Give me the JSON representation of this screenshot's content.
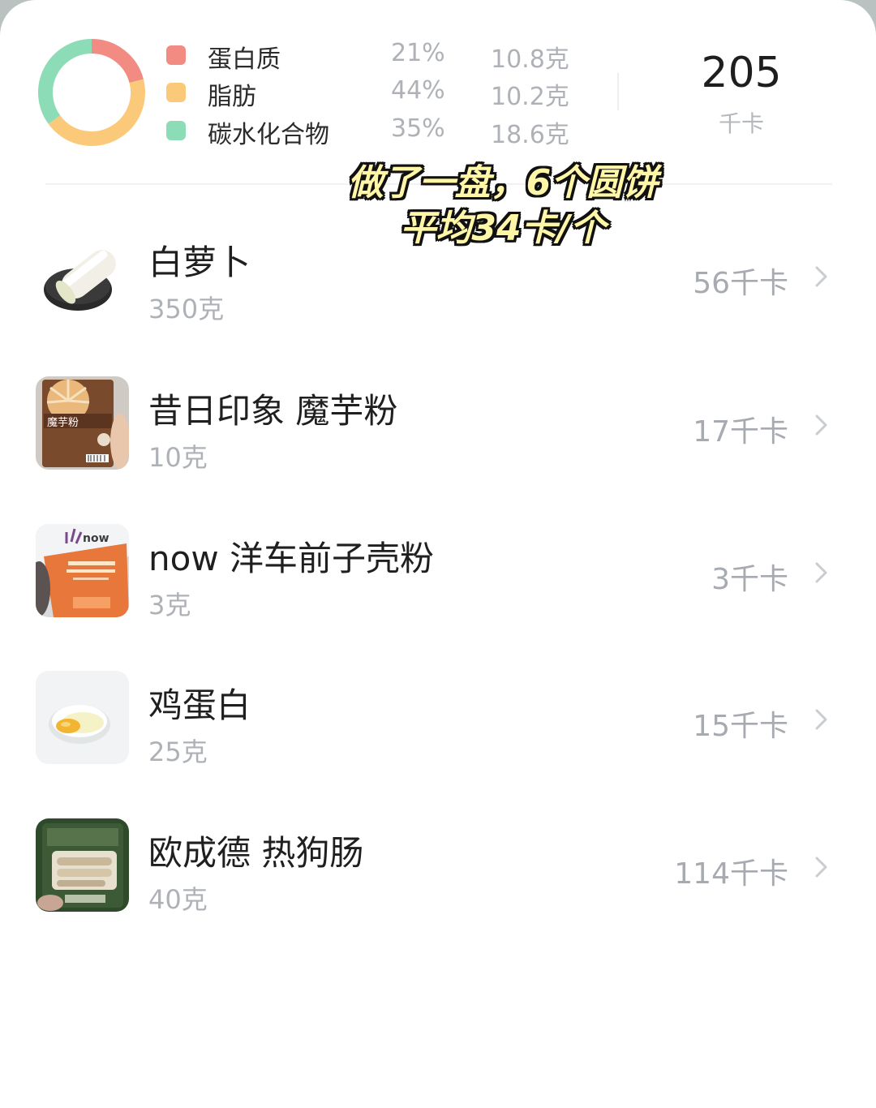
{
  "summary": {
    "macros": [
      {
        "name": "蛋白质",
        "percent": "21%",
        "weight": "10.8克",
        "color": "#f28b82",
        "share": 0.21
      },
      {
        "name": "脂肪",
        "percent": "44%",
        "weight": "10.2克",
        "color": "#fbc97a",
        "share": 0.44
      },
      {
        "name": "碳水化合物",
        "percent": "35%",
        "weight": "18.6克",
        "color": "#8ddcb8",
        "share": 0.35
      }
    ],
    "total_kcal": "205",
    "total_unit": "千卡"
  },
  "overlay": {
    "line1": "做了一盘，6个圆饼",
    "line2": "平均34卡/个"
  },
  "foods": [
    {
      "name": "白萝卜",
      "weight": "350克",
      "kcal": "56千卡",
      "icon": "white-radish-photo"
    },
    {
      "name": "昔日印象 魔芋粉",
      "weight": "10克",
      "kcal": "17千卡",
      "icon": "konjac-powder-package-photo",
      "package_text": "魔芋粉"
    },
    {
      "name": "now 洋车前子壳粉",
      "weight": "3克",
      "kcal": "3千卡",
      "icon": "psyllium-husk-package-photo",
      "package_text": "now"
    },
    {
      "name": "鸡蛋白",
      "weight": "25克",
      "kcal": "15千卡",
      "icon": "egg-white-photo"
    },
    {
      "name": "欧成德 热狗肠",
      "weight": "40克",
      "kcal": "114千卡",
      "icon": "hot-dog-sausage-package-photo"
    }
  ]
}
